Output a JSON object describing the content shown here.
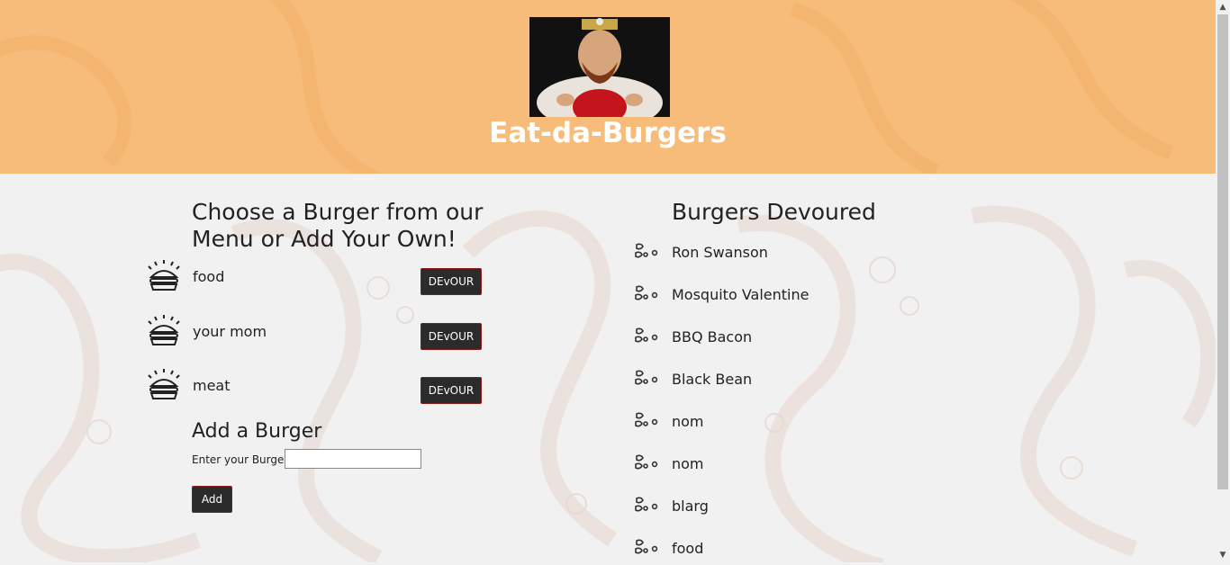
{
  "header": {
    "title": "Eat-da-Burgers",
    "logo_icon": "burger-king-mascot-image"
  },
  "menu": {
    "heading": "Choose a Burger from our Menu or Add Your Own!",
    "items": [
      {
        "name": "food",
        "button_label": "DEvOUR",
        "icon": "burger-icon"
      },
      {
        "name": "your mom",
        "button_label": "DEvOUR",
        "icon": "burger-icon"
      },
      {
        "name": "meat",
        "button_label": "DEvOUR",
        "icon": "burger-icon"
      }
    ]
  },
  "add_form": {
    "heading": "Add a Burger",
    "label": "Enter your Burger",
    "input_value": "",
    "input_placeholder": "",
    "submit_label": "Add"
  },
  "devoured": {
    "heading": "Burgers Devoured",
    "items": [
      {
        "name": "Ron Swanson",
        "icon": "crumbs-icon"
      },
      {
        "name": "Mosquito Valentine",
        "icon": "crumbs-icon"
      },
      {
        "name": "BBQ Bacon",
        "icon": "crumbs-icon"
      },
      {
        "name": "Black Bean",
        "icon": "crumbs-icon"
      },
      {
        "name": "nom",
        "icon": "crumbs-icon"
      },
      {
        "name": "nom",
        "icon": "crumbs-icon"
      },
      {
        "name": "blarg",
        "icon": "crumbs-icon"
      },
      {
        "name": "food",
        "icon": "crumbs-icon"
      }
    ]
  },
  "colors": {
    "header_bg": "#f7bc7a",
    "page_bg": "#f1f1f1",
    "button_bg": "#2b2b2b",
    "button_border": "#8b1a1a"
  }
}
